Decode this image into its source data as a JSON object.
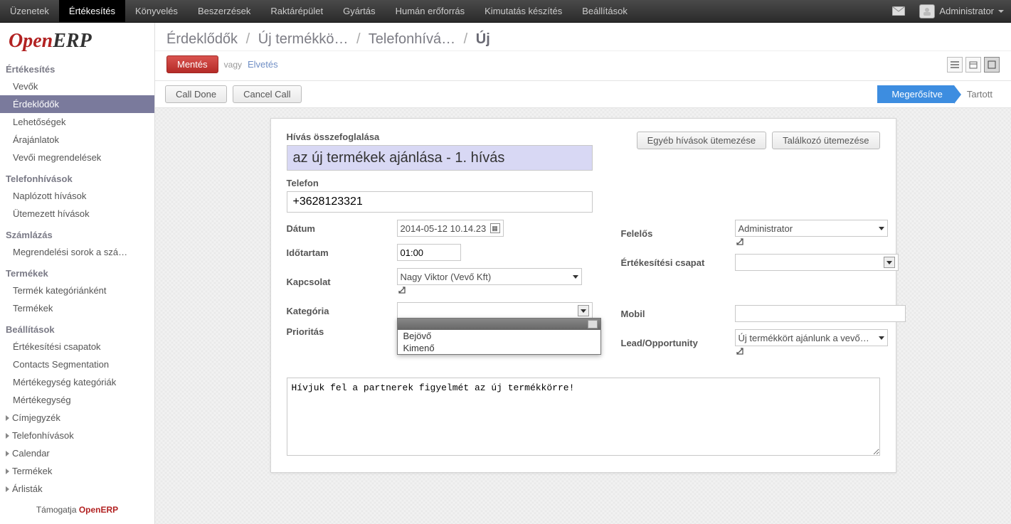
{
  "top_nav": {
    "items": [
      "Üzenetek",
      "Értékesítés",
      "Könyvelés",
      "Beszerzések",
      "Raktárépület",
      "Gyártás",
      "Humán erőforrás",
      "Kimutatás készítés",
      "Beállítások"
    ],
    "active_index": 1,
    "user": "Administrator"
  },
  "sidebar": {
    "sections": [
      {
        "title": "Értékesítés",
        "items": [
          "Vevők",
          "Érdeklődők",
          "Lehetőségek",
          "Árajánlatok",
          "Vevői megrendelések"
        ],
        "active_index": 1
      },
      {
        "title": "Telefonhívások",
        "items": [
          "Naplózott hívások",
          "Ütemezett hívások"
        ]
      },
      {
        "title": "Számlázás",
        "items": [
          "Megrendelési sorok a szá…"
        ]
      },
      {
        "title": "Termékek",
        "items": [
          "Termék kategóriánként",
          "Termékek"
        ]
      },
      {
        "title": "Beállítások",
        "items": [
          "Értékesítési csapatok",
          "Contacts Segmentation",
          "Mértékegység kategóriák",
          "Mértékegység"
        ]
      }
    ],
    "expandables": [
      "Címjegyzék",
      "Telefonhívások",
      "Calendar",
      "Termékek",
      "Árlisták"
    ],
    "footer_pre": "Támogatja ",
    "footer_link": "OpenERP"
  },
  "breadcrumbs": [
    "Érdeklődők",
    "Új termékkö…",
    "Telefonhívá…",
    "Új"
  ],
  "actions": {
    "save": "Mentés",
    "or": "vagy",
    "discard": "Elvetés"
  },
  "status": {
    "call_done": "Call Done",
    "cancel_call": "Cancel Call",
    "confirmed": "Megerősítve",
    "held": "Tartott"
  },
  "sheet": {
    "summary_label": "Hívás összefoglalása",
    "summary_value": "az új termékek ajánlása - 1. hívás",
    "phone_label": "Telefon",
    "phone_value": "+3628123321",
    "btn_other_calls": "Egyéb hívások ütemezése",
    "btn_meeting": "Találkozó ütemezése",
    "date_label": "Dátum",
    "date_value": "2014-05-12 10.14.23",
    "duration_label": "Időtartam",
    "duration_value": "01:00",
    "contact_label": "Kapcsolat",
    "contact_value": "Nagy Viktor (Vevő Kft)",
    "category_label": "Kategória",
    "category_value": "",
    "category_options": [
      "Bejövő",
      "Kimenő"
    ],
    "priority_label": "Prioritás",
    "responsible_label": "Felelős",
    "responsible_value": "Administrator",
    "team_label": "Értékesítési csapat",
    "team_value": "",
    "mobile_label": "Mobil",
    "mobile_value": "",
    "lead_label": "Lead/Opportunity",
    "lead_value": "Új termékkört ajánlunk a vevőknek",
    "notes_value": "Hívjuk fel a partnerek figyelmét az új termékkörre!"
  }
}
